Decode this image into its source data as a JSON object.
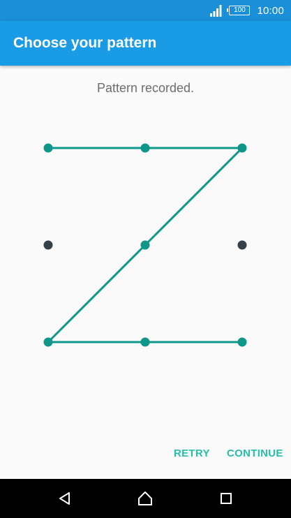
{
  "status_bar": {
    "battery_label": "100",
    "time": "10:00",
    "icons": [
      "signal-icon",
      "battery-icon"
    ]
  },
  "app_bar": {
    "title": "Choose your pattern"
  },
  "pattern": {
    "message": "Pattern recorded.",
    "grid_size": 3,
    "recorded_sequence": [
      0,
      1,
      2,
      4,
      6,
      7,
      8
    ],
    "colors": {
      "active": "#0e9688",
      "inactive": "#37414a",
      "line": "#0e9688"
    }
  },
  "actions": {
    "retry_label": "RETRY",
    "continue_label": "CONTINUE"
  },
  "nav_bar": {
    "icons": [
      "back-icon",
      "home-icon",
      "recent-apps-icon"
    ]
  },
  "colors": {
    "status_bar": "#1a8fd8",
    "app_bar": "#1a9be6",
    "accent_text": "#26bfa7",
    "background": "#fafafa"
  }
}
